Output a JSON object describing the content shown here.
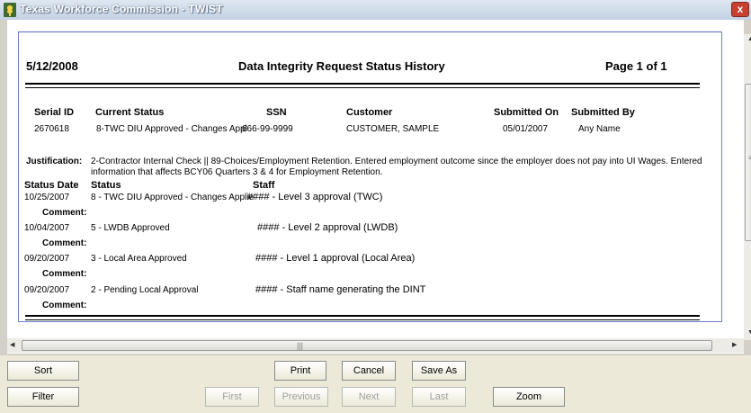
{
  "window": {
    "title": "Texas Workforce Commission - TWIST",
    "close_glyph": "x"
  },
  "report": {
    "date": "5/12/2008",
    "title": "Data Integrity Request Status History",
    "page": "Page 1 of 1",
    "columns": [
      "Serial ID",
      "Current Status",
      "SSN",
      "Customer",
      "Submitted On",
      "Submitted By"
    ],
    "row": {
      "serial_id": "2670618",
      "current_status": "8-TWC DIU Approved - Changes Appl",
      "ssn": "666-99-9999",
      "customer": "CUSTOMER, SAMPLE",
      "submitted_on": "05/01/2007",
      "submitted_by": "Any Name"
    },
    "justification_label": "Justification:",
    "justification_text": "2-Contractor Internal Check || 89-Choices/Employment Retention.  Entered employment outcome since the employer does not pay into UI Wages.  Entered information that affects BCY06 Quarters 3 & 4 for Employment Retention.",
    "history_headers": {
      "date": "Status Date",
      "status": "Status",
      "staff": "Staff"
    },
    "comment_label": "Comment:",
    "history": [
      {
        "date": "10/25/2007",
        "status": "8 - TWC DIU Approved - Changes Applie",
        "staff": "#### - Level 3 approval (TWC)"
      },
      {
        "date": "10/04/2007",
        "status": "5 - LWDB Approved",
        "staff": "#### - Level 2 approval (LWDB)"
      },
      {
        "date": "09/20/2007",
        "status": "3 - Local Area Approved",
        "staff": "#### - Level 1 approval (Local Area)"
      },
      {
        "date": "09/20/2007",
        "status": "2 - Pending Local Approval",
        "staff": "#### - Staff name generating the DINT"
      }
    ]
  },
  "buttons": {
    "sort": "Sort",
    "print": "Print",
    "cancel": "Cancel",
    "save_as": "Save As",
    "filter": "Filter",
    "first": "First",
    "previous": "Previous",
    "next": "Next",
    "last": "Last",
    "zoom": "Zoom"
  },
  "colors": {
    "title_bar": "#c3d2e4",
    "close": "#c74030",
    "report_border": "#6a7fc8"
  },
  "icons": {
    "app": "plant-icon"
  }
}
